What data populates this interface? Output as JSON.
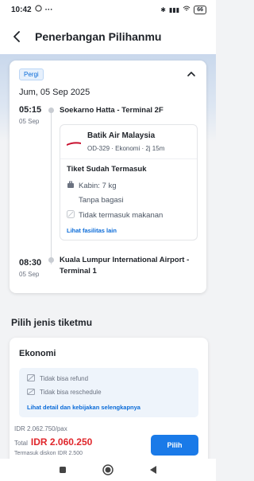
{
  "status_bar": {
    "time": "10:42",
    "battery": "66"
  },
  "header": {
    "title": "Penerbangan Pilihanmu"
  },
  "flight": {
    "badge": "Pergi",
    "date": "Jum, 05 Sep 2025",
    "departure": {
      "time": "05:15",
      "date": "05 Sep",
      "airport": "Soekarno Hatta - Terminal 2F"
    },
    "airline": {
      "name": "Batik Air Malaysia",
      "info": "OD-329 · Ekonomi · 2j 15m"
    },
    "included": {
      "title": "Tiket Sudah Termasuk",
      "cabin": "Kabin: 7 kg",
      "baggage": "Tanpa bagasi",
      "meal": "Tidak termasuk makanan",
      "link": "Lihat fasilitas lain"
    },
    "arrival": {
      "time": "08:30",
      "date": "05 Sep",
      "airport": "Kuala Lumpur International Airport - Terminal 1"
    }
  },
  "ticket_section": {
    "title": "Pilih jenis tiketmu",
    "class": "Ekonomi",
    "policies": {
      "refund": "Tidak bisa refund",
      "reschedule": "Tidak bisa reschedule",
      "link": "Lihat detail dan kebijakan selengkapnya"
    },
    "price_per_pax": "IDR 2.062.750/pax",
    "total_label": "Total",
    "total_price": "IDR 2.060.250",
    "tax_note": "Termasuk diskon IDR 2.500",
    "select_label": "Pilih"
  },
  "colors": {
    "accent": "#1a7ae8",
    "price": "#e0262b"
  }
}
